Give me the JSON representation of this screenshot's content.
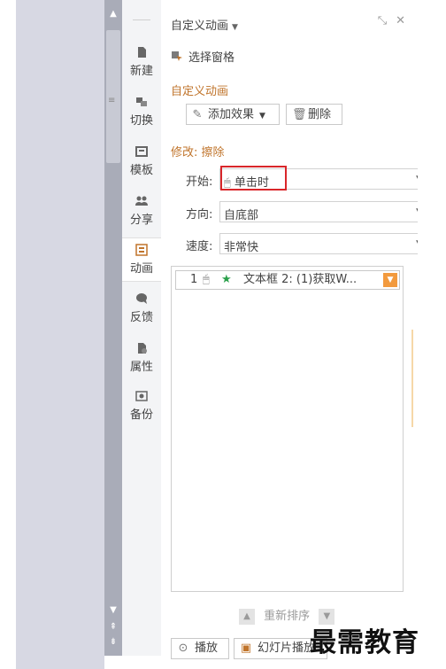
{
  "panel": {
    "title": "自定义动画",
    "selection_pane": "选择窗格",
    "custom_animation_section": "自定义动画",
    "add_effect": "添加效果",
    "delete": "删除",
    "modify_section": "修改: 擦除",
    "start_label": "开始:",
    "start_value": "单击时",
    "direction_label": "方向:",
    "direction_value": "自底部",
    "speed_label": "速度:",
    "speed_value": "非常快",
    "list": [
      {
        "num": "1",
        "text": "文本框 2: (1)获取W..."
      }
    ],
    "reorder": "重新排序",
    "play": "播放",
    "slideshow": "幻灯片播放"
  },
  "sidebar": {
    "items": [
      {
        "label": "新建",
        "icon": "new-icon"
      },
      {
        "label": "切换",
        "icon": "switch-icon"
      },
      {
        "label": "模板",
        "icon": "template-icon"
      },
      {
        "label": "分享",
        "icon": "share-icon"
      },
      {
        "label": "动画",
        "icon": "animation-icon"
      },
      {
        "label": "反馈",
        "icon": "feedback-icon"
      },
      {
        "label": "属性",
        "icon": "properties-icon"
      },
      {
        "label": "备份",
        "icon": "backup-icon"
      }
    ]
  },
  "watermark": "最需教育",
  "colors": {
    "section": "#c0742b",
    "highlight": "#d9262a",
    "star": "#2aa04a",
    "dropdown_accent": "#f29a3e"
  }
}
